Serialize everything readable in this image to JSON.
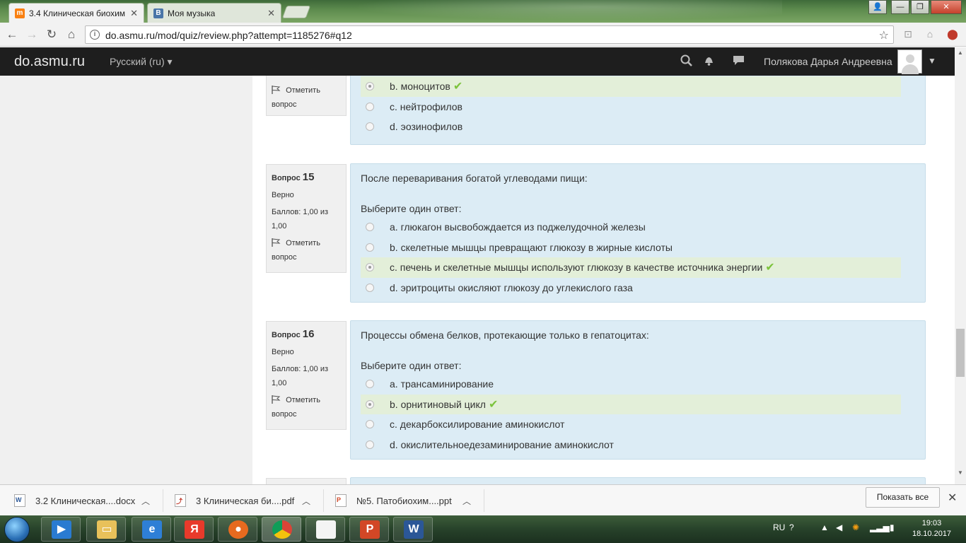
{
  "browser": {
    "tabs": [
      {
        "title": "3.4 Клиническая биохим",
        "active": true,
        "icon": "moodle-icon"
      },
      {
        "title": "Моя музыка",
        "active": false,
        "icon": "vk-icon"
      }
    ],
    "window_controls": {
      "minimize": "—",
      "maximize": "❐",
      "close": "✕"
    },
    "url": "do.asmu.ru/mod/quiz/review.php?attempt=1185276#q12"
  },
  "navbar": {
    "brand": "do.asmu.ru",
    "language": "Русский (ru)",
    "username": "Полякова Дарья Андреевна",
    "icons": [
      "search-icon",
      "bell-icon",
      "chat-icon"
    ]
  },
  "questions": {
    "q14": {
      "flag_label": "Отметить вопрос",
      "answers": [
        {
          "label": "b. моноцитов",
          "selected": true,
          "correct": true
        },
        {
          "label": "c. нейтрофилов",
          "selected": false,
          "correct": false
        },
        {
          "label": "d. эозинофилов",
          "selected": false,
          "correct": false
        }
      ]
    },
    "q15": {
      "prefix": "Вопрос",
      "number": "15",
      "status": "Верно",
      "score": "Баллов: 1,00 из 1,00",
      "flag_label": "Отметить вопрос",
      "text": "После переваривания богатой углеводами пищи:",
      "prompt": "Выберите один ответ:",
      "answers": [
        {
          "label": "a. глюкагон высвобождается из поджелудочной железы",
          "selected": false,
          "correct": false
        },
        {
          "label": "b. скелетные мышцы превращают глюкозу в жирные кислоты",
          "selected": false,
          "correct": false
        },
        {
          "label": "c. печень и скелетные мышцы используют глюкозу в качестве источника энергии",
          "selected": true,
          "correct": true
        },
        {
          "label": "d. эритроциты окисляют глюкозу до углекислого газа",
          "selected": false,
          "correct": false
        }
      ]
    },
    "q16": {
      "prefix": "Вопрос",
      "number": "16",
      "status": "Верно",
      "score": "Баллов: 1,00 из 1,00",
      "flag_label": "Отметить вопрос",
      "text": "Процессы обмена белков, протекающие только в гепатоцитах:",
      "prompt": "Выберите один ответ:",
      "answers": [
        {
          "label": "a. трансаминирование",
          "selected": false,
          "correct": false
        },
        {
          "label": "b. орнитиновый цикл",
          "selected": true,
          "correct": true
        },
        {
          "label": "c. декарбоксилирование аминокислот",
          "selected": false,
          "correct": false
        },
        {
          "label": "d. окислительноедезаминирование аминокислот",
          "selected": false,
          "correct": false
        }
      ]
    }
  },
  "downloads": {
    "items": [
      {
        "name": "3.2 Клиническая....docx",
        "type": "W"
      },
      {
        "name": "3 Клиническая би....pdf",
        "type": "pdf"
      },
      {
        "name": "№5. Патобиохим....ppt",
        "type": "P"
      }
    ],
    "show_all": "Показать все"
  },
  "taskbar": {
    "language": "RU",
    "time": "19:03",
    "date": "18.10.2017"
  },
  "colors": {
    "correct_tick": "#7cc33c",
    "question_bg": "#dcecf5",
    "correct_answer_bg": "#e3efd9",
    "navbar_bg": "#1e1e1e"
  }
}
